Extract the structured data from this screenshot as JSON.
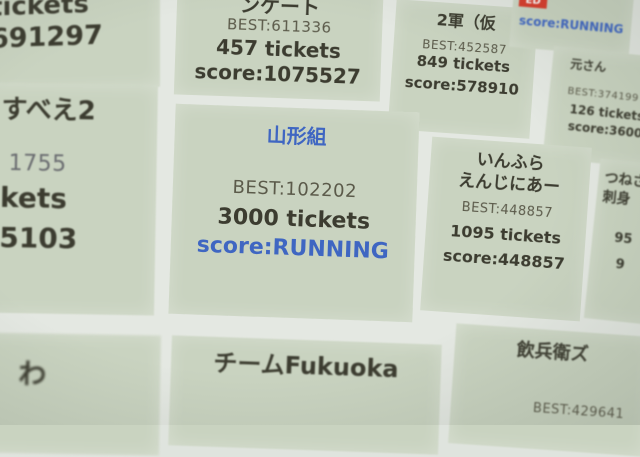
{
  "tiles": [
    {
      "key": "top-left",
      "lines": [
        "tickets",
        "691297"
      ]
    },
    {
      "key": "top-center",
      "name": "ンケート",
      "best": "BEST:611336",
      "tickets": "457 tickets",
      "score": "score:1075527"
    },
    {
      "key": "top-right-a",
      "name": "2軍（仮",
      "best": "BEST:452587",
      "tickets": "849 tickets",
      "score": "score:578910"
    },
    {
      "key": "top-right-b",
      "badge": "ED",
      "score": "score:RUNNING"
    },
    {
      "key": "right-b",
      "name": "元さん",
      "best": "BEST:374199",
      "tickets": "126 tickets",
      "score": "score:3600"
    },
    {
      "key": "mid-left",
      "lines": [
        "すべえ2",
        "1755",
        "kets",
        "5103"
      ]
    },
    {
      "key": "center",
      "name": "山形組",
      "best": "BEST:102202",
      "tickets": "3000 tickets",
      "score": "score:RUNNING"
    },
    {
      "key": "mid-right",
      "name_line1": "いんふら",
      "name_line2": "えんじにあー",
      "best": "BEST:448857",
      "tickets": "1095 tickets",
      "score": "score:448857"
    },
    {
      "key": "far-right",
      "lines": [
        "つねさ",
        "刺身",
        "95",
        "9"
      ]
    },
    {
      "key": "bottom-left",
      "lines": [
        "わ"
      ]
    },
    {
      "key": "bottom-center",
      "name": "チームFukuoka"
    },
    {
      "key": "bottom-right",
      "name": "飲兵衛ズ",
      "best": "BEST:429641"
    }
  ],
  "colors": {
    "tile": "#c9d3c0",
    "background": "#e4e8e2",
    "text": "#3c3c30",
    "accent_blue": "#3f66c2",
    "badge_red": "#d83a2a"
  }
}
